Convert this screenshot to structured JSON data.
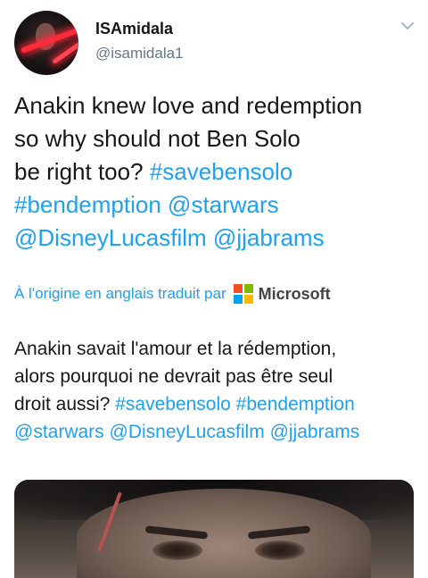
{
  "author": {
    "name": "ISAmidala",
    "handle": "@isamidala1"
  },
  "tweet": {
    "text_lines": [
      [
        {
          "t": "Anakin knew love and redemption",
          "link": false
        }
      ],
      [
        {
          "t": "so why should not Ben Solo",
          "link": false
        }
      ],
      [
        {
          "t": "be right too? ",
          "link": false
        },
        {
          "t": "#savebensolo",
          "link": true
        }
      ],
      [
        {
          "t": "#bendemption",
          "link": true
        },
        {
          "t": " ",
          "link": false
        },
        {
          "t": "@starwars",
          "link": true
        }
      ],
      [
        {
          "t": "@DisneyLucasfilm",
          "link": true
        },
        {
          "t": " ",
          "link": false
        },
        {
          "t": "@jjabrams",
          "link": true
        }
      ]
    ]
  },
  "translation": {
    "label": "À l'origine en anglais traduit par",
    "provider": "Microsoft",
    "logo_colors": [
      "#f25022",
      "#7fba00",
      "#00a4ef",
      "#ffb900"
    ],
    "text_lines": [
      [
        {
          "t": "Anakin savait l'amour et la rédemption,",
          "link": false
        }
      ],
      [
        {
          "t": "alors pourquoi ne devrait pas être seul",
          "link": false
        }
      ],
      [
        {
          "t": "droit aussi? ",
          "link": false
        },
        {
          "t": "#savebensolo",
          "link": true
        },
        {
          "t": " ",
          "link": false
        },
        {
          "t": "#bendemption",
          "link": true
        }
      ],
      [
        {
          "t": "@starwars",
          "link": true
        },
        {
          "t": " ",
          "link": false
        },
        {
          "t": "@DisneyLucasfilm",
          "link": true
        },
        {
          "t": " ",
          "link": false
        },
        {
          "t": "@jjabrams",
          "link": true
        }
      ]
    ]
  },
  "icons": {
    "caret": "chevron-down-icon",
    "avatar": "profile-avatar"
  },
  "colors": {
    "link": "#1da1f2",
    "text": "#14171a",
    "secondary": "#657786"
  }
}
